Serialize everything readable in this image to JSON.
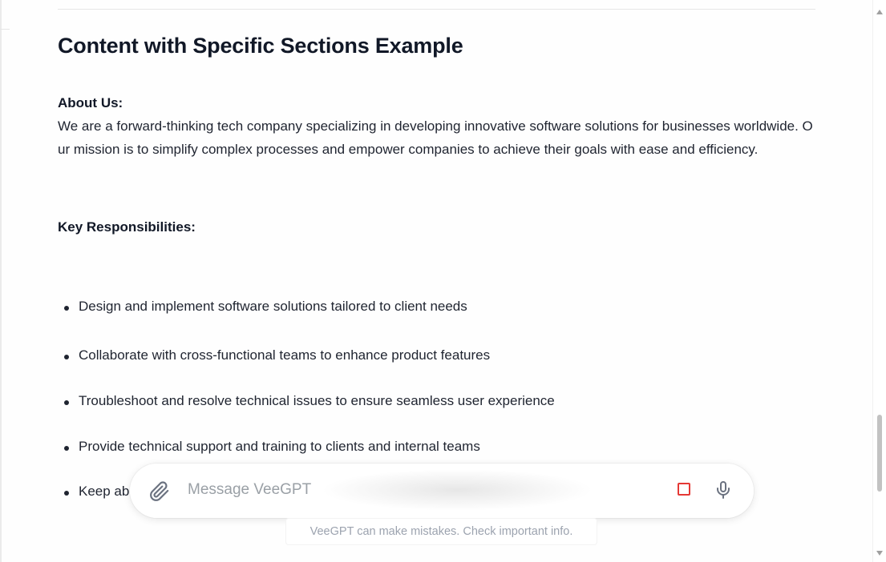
{
  "article": {
    "title": "Content with Specific Sections Example",
    "about_heading": "About Us:",
    "about_body": "We are a forward-thinking tech company specializing in developing innovative software solutions for businesses worldwide. Our mission is to simplify complex processes and empower companies to achieve their goals with ease and efficiency.",
    "responsibilities_heading": "Key Responsibilities:",
    "responsibilities": [
      "Design and implement software solutions tailored to client needs",
      "Collaborate with cross-functional teams to enhance product features",
      "Troubleshoot and resolve technical issues to ensure seamless user experience",
      "Provide technical support and training to clients and internal teams",
      "Keep ab"
    ]
  },
  "composer": {
    "placeholder": "Message VeeGPT",
    "value": "",
    "attach_icon": "paperclip-icon",
    "stop_icon": "stop-square-icon",
    "mic_icon": "microphone-icon",
    "stop_color": "#e53935"
  },
  "footer": {
    "disclaimer": "VeeGPT can make mistakes. Check important info."
  }
}
